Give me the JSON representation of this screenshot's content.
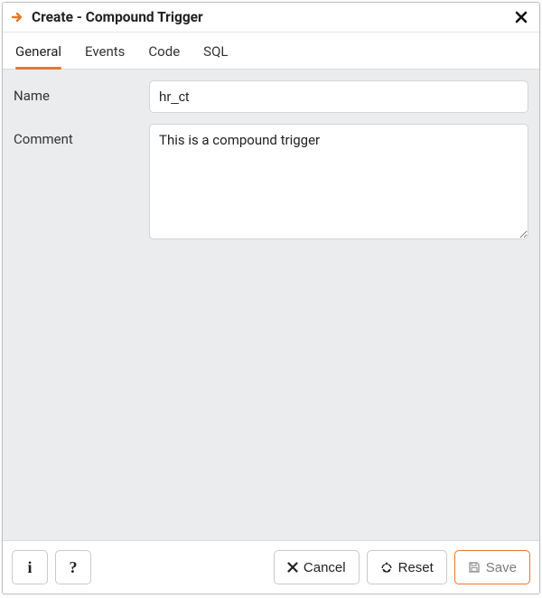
{
  "header": {
    "title": "Create - Compound Trigger"
  },
  "tabs": [
    {
      "label": "General",
      "active": true
    },
    {
      "label": "Events",
      "active": false
    },
    {
      "label": "Code",
      "active": false
    },
    {
      "label": "SQL",
      "active": false
    }
  ],
  "form": {
    "name": {
      "label": "Name",
      "value": "hr_ct"
    },
    "comment": {
      "label": "Comment",
      "value": "This is a compound trigger"
    }
  },
  "footer": {
    "info_label": "i",
    "help_label": "?",
    "cancel_label": "Cancel",
    "reset_label": "Reset",
    "save_label": "Save"
  },
  "colors": {
    "accent": "#e8762d"
  }
}
